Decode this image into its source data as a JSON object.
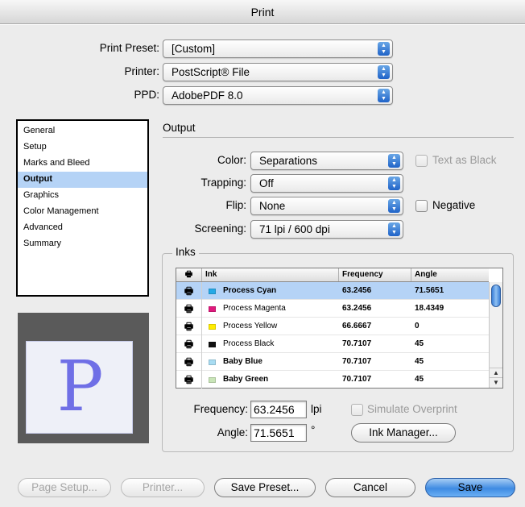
{
  "window": {
    "title": "Print"
  },
  "header": {
    "print_preset_label": "Print Preset:",
    "print_preset_value": "[Custom]",
    "printer_label": "Printer:",
    "printer_value": "PostScript® File",
    "ppd_label": "PPD:",
    "ppd_value": "AdobePDF 8.0"
  },
  "sidebar": {
    "items": [
      {
        "label": "General"
      },
      {
        "label": "Setup"
      },
      {
        "label": "Marks and Bleed"
      },
      {
        "label": "Output"
      },
      {
        "label": "Graphics"
      },
      {
        "label": "Color Management"
      },
      {
        "label": "Advanced"
      },
      {
        "label": "Summary"
      }
    ],
    "selected": "Output"
  },
  "output": {
    "section_title": "Output",
    "color_label": "Color:",
    "color_value": "Separations",
    "text_as_black_label": "Text as Black",
    "text_as_black_checked": false,
    "trapping_label": "Trapping:",
    "trapping_value": "Off",
    "flip_label": "Flip:",
    "flip_value": "None",
    "negative_label": "Negative",
    "negative_checked": false,
    "screening_label": "Screening:",
    "screening_value": "71 lpi / 600 dpi"
  },
  "inks": {
    "section_title": "Inks",
    "columns": [
      "Ink",
      "Frequency",
      "Angle"
    ],
    "rows": [
      {
        "name": "Process Cyan",
        "frequency": "63.2456",
        "angle": "71.5651",
        "color": "#25a9e6",
        "selected": true
      },
      {
        "name": "Process Magenta",
        "frequency": "63.2456",
        "angle": "18.4349",
        "color": "#e0197d",
        "selected": false
      },
      {
        "name": "Process Yellow",
        "frequency": "66.6667",
        "angle": "0",
        "color": "#ffec00",
        "selected": false
      },
      {
        "name": "Process Black",
        "frequency": "70.7107",
        "angle": "45",
        "color": "#111111",
        "selected": false
      },
      {
        "name": "Baby Blue",
        "frequency": "70.7107",
        "angle": "45",
        "color": "#a8dcf2",
        "selected": false
      },
      {
        "name": "Baby Green",
        "frequency": "70.7107",
        "angle": "45",
        "color": "#c9e5b8",
        "selected": false
      }
    ],
    "frequency_label": "Frequency:",
    "frequency_value": "63.2456",
    "frequency_unit": "lpi",
    "angle_label": "Angle:",
    "angle_value": "71.5651",
    "angle_unit": "°",
    "simulate_overprint_label": "Simulate Overprint",
    "simulate_overprint_checked": false,
    "ink_manager_label": "Ink Manager..."
  },
  "preview": {
    "glyph": "P"
  },
  "footer": {
    "page_setup_label": "Page Setup...",
    "printer_label": "Printer...",
    "save_preset_label": "Save Preset...",
    "cancel_label": "Cancel",
    "save_label": "Save"
  },
  "colors": {
    "selection": "#b5d3f6",
    "accent": "#3f8be2",
    "preview_glyph": "#6f6fe6"
  }
}
